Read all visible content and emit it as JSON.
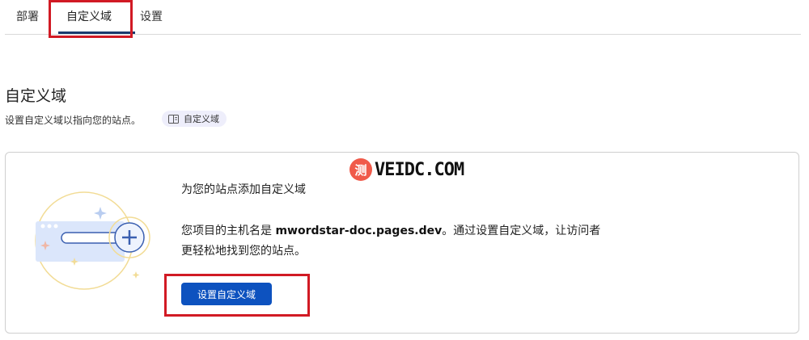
{
  "tabs": [
    {
      "label": "部署"
    },
    {
      "label": "自定义域"
    },
    {
      "label": "设置"
    }
  ],
  "section": {
    "title": "自定义域",
    "description": "设置自定义域以指向您的站点。",
    "doc_chip_label": "自定义域"
  },
  "card": {
    "heading": "为您的站点添加自定义域",
    "body_prefix": "您项目的主机名是 ",
    "hostname": "mwordstar-doc.pages.dev",
    "body_suffix": "。通过设置自定义域，让访问者更轻松地找到您的站点。",
    "button_label": "设置自定义域"
  },
  "watermark": {
    "badge": "测",
    "text": "VEIDC.COM"
  },
  "colors": {
    "accent": "#0d52bf",
    "tab_underline": "#1a3a6e",
    "highlight": "#d11a24",
    "chip_bg": "#eeeefb"
  }
}
